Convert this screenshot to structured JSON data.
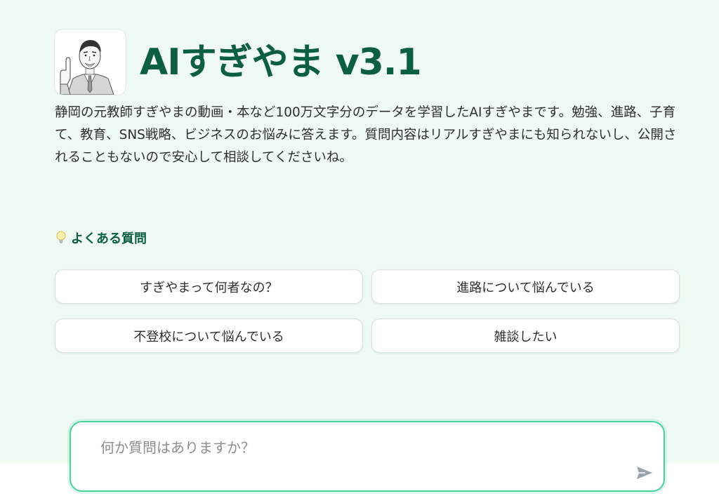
{
  "header": {
    "title": "AIすぎやま v3.1"
  },
  "description": "静岡の元教師すぎやまの動画・本など100万文字分のデータを学習したAIすぎやまです。勉強、進路、子育て、教育、SNS戦略、ビジネスのお悩みに答えます。質問内容はリアルすぎやまにも知られないし、公開されることもないので安心して相談してくださいね。",
  "faq": {
    "heading": "よくある質問",
    "icon": "lightbulb-icon",
    "items": [
      {
        "label": "すぎやまって何者なの？"
      },
      {
        "label": "進路について悩んでいる"
      },
      {
        "label": "不登校について悩んでいる"
      },
      {
        "label": "雑談したい"
      }
    ]
  },
  "chat": {
    "placeholder": "何か質問はありますか？",
    "send_icon": "send-icon"
  },
  "colors": {
    "page_background": "#effaf3",
    "title_green": "#0b5e3f",
    "input_border": "#4ccf9a",
    "send_icon": "#9aa3ad"
  }
}
